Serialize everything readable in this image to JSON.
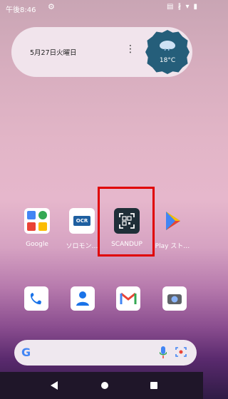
{
  "status_bar": {
    "time": "午後8:46",
    "icons": [
      "gear-icon",
      "sim-icon",
      "bluetooth-icon",
      "wifi-icon",
      "battery-icon"
    ]
  },
  "widget": {
    "date": "5月27日火曜日",
    "menu_icon": "more-vert-icon",
    "weather": {
      "temp": "18°C",
      "icon": "rain-cloud-icon"
    }
  },
  "apps": [
    {
      "label": "Google",
      "icon": "google-folder-icon"
    },
    {
      "label": "ソロモン…",
      "icon": "ocr-icon"
    },
    {
      "label": "SCANDUP",
      "icon": "scandup-icon"
    },
    {
      "label": "Play スト…",
      "icon": "play-store-icon"
    }
  ],
  "dock": [
    {
      "icon": "phone-icon"
    },
    {
      "icon": "contacts-icon"
    },
    {
      "icon": "gmail-icon"
    },
    {
      "icon": "camera-icon"
    }
  ],
  "search": {
    "logo": "G",
    "mic_icon": "mic-icon",
    "lens_icon": "lens-icon"
  },
  "nav": [
    "back-icon",
    "home-icon",
    "recents-icon"
  ],
  "ocr_text": "OCR",
  "highlight_color": "#e00000"
}
